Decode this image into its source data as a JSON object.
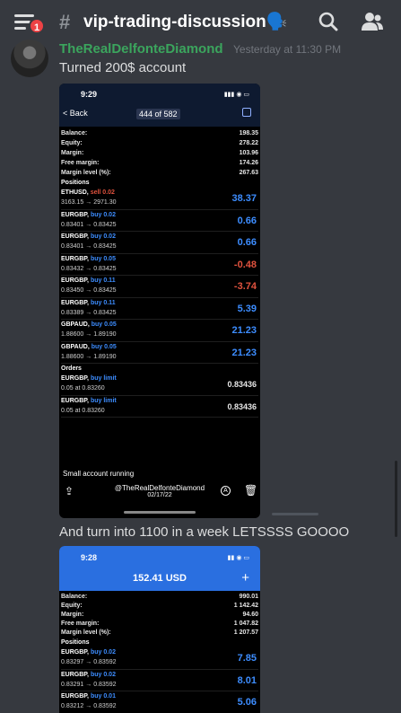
{
  "header": {
    "notification_count": "1",
    "channel_name": "vip-trading-discussion🗣️"
  },
  "message": {
    "author": "TheRealDelfonteDiamond",
    "timestamp": "Yesterday at 11:30 PM",
    "text1": "Turned 200$ account",
    "text2": "And turn into 1100 in a week LETSSSS GOOOO"
  },
  "shot1": {
    "time": "9:29",
    "back_label": "Back",
    "pager": "444 of 582",
    "account": [
      {
        "label": "Balance:",
        "value": "198.35"
      },
      {
        "label": "Equity:",
        "value": "278.22"
      },
      {
        "label": "Margin:",
        "value": "103.96"
      },
      {
        "label": "Free margin:",
        "value": "174.26"
      },
      {
        "label": "Margin level (%):",
        "value": "267.63"
      }
    ],
    "positions_label": "Positions",
    "positions": [
      {
        "symbol": "ETHUSD,",
        "action": "sell 0.02",
        "prices": "3163.15 → 2971.30",
        "pl": "38.37",
        "dir": "sell",
        "plc": "blue"
      },
      {
        "symbol": "EURGBP,",
        "action": "buy 0.02",
        "prices": "0.83401 → 0.83425",
        "pl": "0.66",
        "dir": "buy",
        "plc": "blue"
      },
      {
        "symbol": "EURGBP,",
        "action": "buy 0.02",
        "prices": "0.83401 → 0.83425",
        "pl": "0.66",
        "dir": "buy",
        "plc": "blue"
      },
      {
        "symbol": "EURGBP,",
        "action": "buy 0.05",
        "prices": "0.83432 → 0.83425",
        "pl": "-0.48",
        "dir": "buy",
        "plc": "red"
      },
      {
        "symbol": "EURGBP,",
        "action": "buy 0.11",
        "prices": "0.83450 → 0.83425",
        "pl": "-3.74",
        "dir": "buy",
        "plc": "red"
      },
      {
        "symbol": "EURGBP,",
        "action": "buy 0.11",
        "prices": "0.83389 → 0.83425",
        "pl": "5.39",
        "dir": "buy",
        "plc": "blue"
      },
      {
        "symbol": "GBPAUD,",
        "action": "buy 0.05",
        "prices": "1.88600 → 1.89190",
        "pl": "21.23",
        "dir": "buy",
        "plc": "blue"
      },
      {
        "symbol": "GBPAUD,",
        "action": "buy 0.05",
        "prices": "1.88600 → 1.89190",
        "pl": "21.23",
        "dir": "buy",
        "plc": "blue"
      }
    ],
    "orders_label": "Orders",
    "orders": [
      {
        "symbol": "EURGBP,",
        "action": "buy limit",
        "detail": "0.05 at 0.83260",
        "price": "0.83436"
      },
      {
        "symbol": "EURGBP,",
        "action": "buy limit",
        "detail": "0.05 at 0.83260",
        "price": "0.83436"
      }
    ],
    "caption": "Small account running",
    "watermark": "@TheRealDelfonteDiamond",
    "watermark_date": "02/17/22"
  },
  "shot2": {
    "time": "9:28",
    "balance_title": "152.41 USD",
    "account": [
      {
        "label": "Balance:",
        "value": "990.01"
      },
      {
        "label": "Equity:",
        "value": "1 142.42"
      },
      {
        "label": "Margin:",
        "value": "94.60"
      },
      {
        "label": "Free margin:",
        "value": "1 047.82"
      },
      {
        "label": "Margin level (%):",
        "value": "1 207.57"
      }
    ],
    "positions_label": "Positions",
    "positions": [
      {
        "symbol": "EURGBP,",
        "action": "buy 0.02",
        "prices": "0.83297 → 0.83592",
        "pl": "7.85"
      },
      {
        "symbol": "EURGBP,",
        "action": "buy 0.02",
        "prices": "0.83291 → 0.83592",
        "pl": "8.01"
      },
      {
        "symbol": "EURGBP,",
        "action": "buy 0.01",
        "prices": "0.83212 → 0.83592",
        "pl": "5.06"
      }
    ]
  }
}
